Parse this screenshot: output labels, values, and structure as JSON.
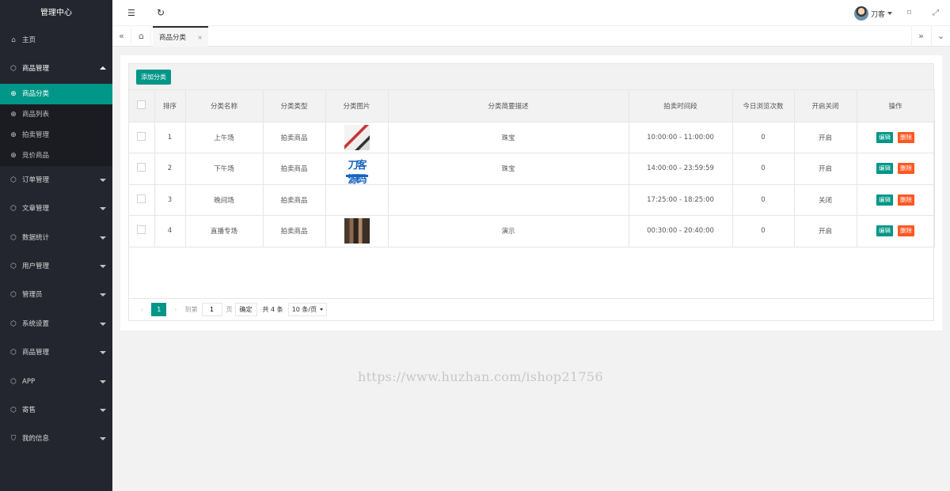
{
  "sidebar": {
    "logo": "管理中心",
    "home": "主页",
    "product_mgmt": "商品管理",
    "sub_items": [
      "商品分类",
      "商品列表",
      "拍卖管理",
      "竞价商品"
    ],
    "items": [
      "订单管理",
      "文章管理",
      "数据统计",
      "用户管理",
      "管理员",
      "系统设置",
      "商品管理",
      "APP",
      "寄售",
      "我的信息"
    ]
  },
  "header": {
    "user_name": "刀客"
  },
  "tabs": {
    "active_tab": "商品分类",
    "close_glyph": "×"
  },
  "toolbar": {
    "add_label": "添加分类"
  },
  "table": {
    "headers": [
      "排序",
      "分类名称",
      "分类类型",
      "分类图片",
      "分类简要描述",
      "拍卖时间段",
      "今日浏览次数",
      "开启关闭",
      "操作"
    ],
    "edit_label": "编辑",
    "delete_label": "删除",
    "rows": [
      {
        "sort": "1",
        "name": "上午场",
        "type": "拍卖商品",
        "desc": "珠宝",
        "time": "10:00:00  -  11:00:00",
        "views": "0",
        "status": "开启"
      },
      {
        "sort": "2",
        "name": "下午场",
        "type": "拍卖商品",
        "desc": "珠宝",
        "time": "14:00:00  -  23:59:59",
        "views": "0",
        "status": "开启"
      },
      {
        "sort": "3",
        "name": "晚间场",
        "type": "拍卖商品",
        "desc": "",
        "time": "17:25:00  -  18:25:00",
        "views": "0",
        "status": "关闭"
      },
      {
        "sort": "4",
        "name": "直播专场",
        "type": "拍卖商品",
        "desc": "演示",
        "time": "00:30:00  -  20:40:00",
        "views": "0",
        "status": "开启"
      }
    ]
  },
  "thumbs": {
    "row2_text": "刀客源码"
  },
  "pager": {
    "current": "1",
    "goto_label": "到第",
    "page_value": "1",
    "page_unit": "页",
    "confirm": "确定",
    "total": "共 4 条",
    "per_page": "10 条/页"
  },
  "watermark": "https://www.huzhan.com/ishop21756"
}
